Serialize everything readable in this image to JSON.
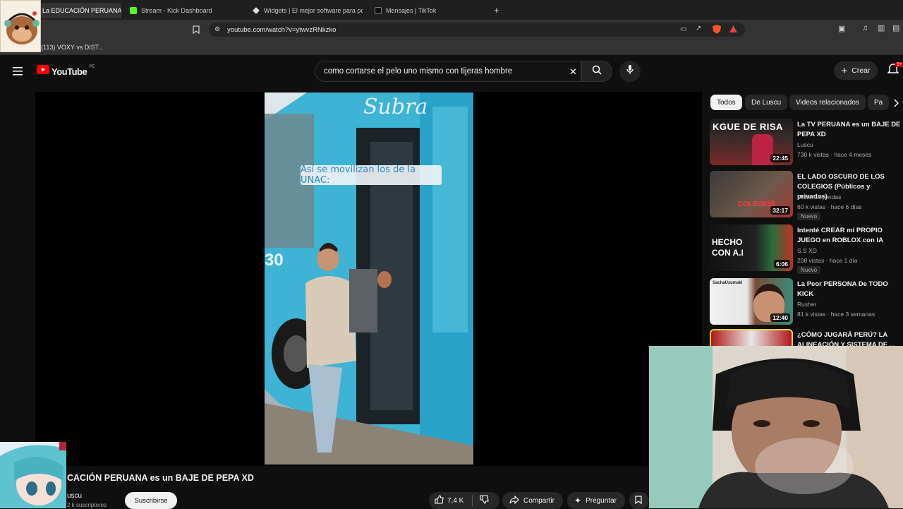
{
  "browser": {
    "tabs": [
      {
        "label": "La EDUCACIÓN PERUANA",
        "active": true
      },
      {
        "label": "Stream - Kick Dashboard",
        "active": false
      },
      {
        "label": "Widgets | El mejor software para pot",
        "active": false
      },
      {
        "label": "Mensajes | TikTok",
        "active": false
      }
    ],
    "url": "youtube.com/watch?v=ytwvzRNkzko",
    "bookmark": "(113) VOXY vs DIST..."
  },
  "youtube": {
    "logo_text": "YouTube",
    "region": "PE",
    "search_value": "como cortarse el pelo uno mismo con tijeras hombre",
    "create_label": "Crear",
    "notifications_badge": "9+"
  },
  "player": {
    "caption": "Así se movilizan los de la UNAC:",
    "bus_text": "Subra",
    "bus_number": "30"
  },
  "video": {
    "title": "CACIÓN PERUANA es un BAJE DE PEPA XD",
    "channel": "uscu",
    "subscribers": "2 k suscriptores",
    "subscribe_label": "Suscribirse",
    "likes": "7,4 K",
    "share_label": "Compartir",
    "ask_label": "Preguntar"
  },
  "chips": [
    "Todos",
    "De Luscu",
    "Videos relacionados",
    "Pa"
  ],
  "recommendations": [
    {
      "title": "La TV PERUANA es un BAJE DE PEPA XD",
      "channel": "Luscu",
      "meta": "730 k vistas · hace 4 meses",
      "duration": "22:45",
      "badge": "",
      "thumb_text": "KGUE DE RISA"
    },
    {
      "title": "EL LADO OSCURO DE LOS COLEGIOS (Públicos y privados)",
      "channel": "Mister Leyendas",
      "meta": "60 k vistas · hace 6 días",
      "duration": "32:17",
      "badge": "Nuevo",
      "thumb_text": "COLEGIOS"
    },
    {
      "title": "Intenté CREAR mi PROPIO JUEGO en ROBLOX con IA",
      "channel": "S.S XD",
      "meta": "208 vistas · hace 1 día",
      "duration": "6:06",
      "badge": "Nuevo",
      "thumb_text": "HECHO CON A.I"
    },
    {
      "title": "La Peor PERSONA De TODO KICK",
      "channel": "Rusher",
      "meta": "81 k vistas · hace 3 semanas",
      "duration": "12:40",
      "badge": "",
      "thumb_text": "SachaUzumaki"
    },
    {
      "title": "¿CÓMO JUGARÁ PERÚ? LA ALINEACIÓN Y SISTEMA DE ...",
      "channel": "",
      "meta": "",
      "duration": "",
      "badge": "",
      "thumb_text": ""
    }
  ],
  "colors": {
    "youtube_red": "#ff0000",
    "kick_green": "#53fc18",
    "background": "#0f0f0f"
  }
}
